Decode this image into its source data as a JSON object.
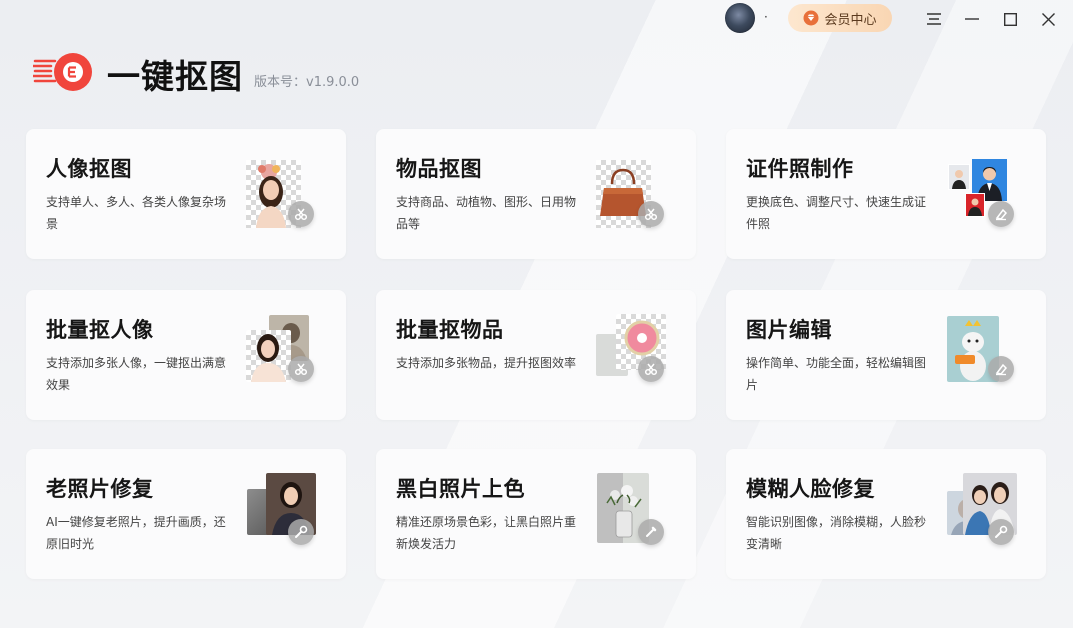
{
  "header": {
    "username": "·",
    "vip_label": "会员中心",
    "app_title": "一键抠图",
    "version": "版本号：v1.9.0.0"
  },
  "cards": [
    {
      "title": "人像抠图",
      "desc": "支持单人、多人、各类人像复杂场景"
    },
    {
      "title": "物品抠图",
      "desc": "支持商品、动植物、图形、日用物品等"
    },
    {
      "title": "证件照制作",
      "desc": "更换底色、调整尺寸、快速生成证件照"
    },
    {
      "title": "批量抠人像",
      "desc": "支持添加多张人像，一键抠出满意效果"
    },
    {
      "title": "批量抠物品",
      "desc": "支持添加多张物品，提升抠图效率"
    },
    {
      "title": "图片编辑",
      "desc": "操作简单、功能全面，轻松编辑图片"
    },
    {
      "title": "老照片修复",
      "desc": "AI一键修复老照片，提升画质，还原旧时光"
    },
    {
      "title": "黑白照片上色",
      "desc": "精准还原场景色彩，让黑白照片重新焕发活力"
    },
    {
      "title": "模糊人脸修复",
      "desc": "智能识别图像，消除模糊，人脸秒变清晰"
    }
  ],
  "colors": {
    "brand_red": "#f0453c",
    "vip_bg": "#fbdcbc",
    "vip_text": "#5b3a1e"
  },
  "icons": {
    "vip": "diamond-icon",
    "menu": "menu-icon",
    "minimize": "minimize-icon",
    "maximize": "maximize-icon",
    "close": "close-icon"
  }
}
